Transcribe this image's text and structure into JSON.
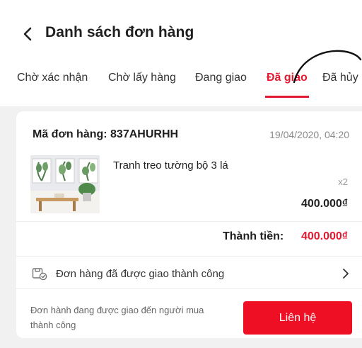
{
  "header": {
    "title": "Danh sách đơn hàng",
    "back_icon": "chevron-left-icon"
  },
  "tabs": [
    {
      "label": "Chờ xác nhận",
      "active": false
    },
    {
      "label": "Chờ lấy hàng",
      "active": false
    },
    {
      "label": "Đang giao",
      "active": false
    },
    {
      "label": "Đã giao",
      "active": true
    },
    {
      "label": "Đã hủy",
      "active": false
    }
  ],
  "colors": {
    "accent": "#e3192f",
    "button": "#ef0f24",
    "background": "#f1f1f1"
  },
  "order": {
    "id_text": "Mã đơn hàng: 837AHURHH",
    "date": "19/04/2020, 04:20",
    "product": {
      "name": "Tranh treo tường bộ 3 lá",
      "quantity": "x2",
      "price": "400.000₫"
    },
    "total_label": "Thành tiền:",
    "total_value": "400.000₫",
    "status_icon": "delivery-box-icon",
    "status_text": "Đơn hàng đã được giao thành công",
    "note": "Đơn hành đang được giao đến người mua thành công",
    "contact_label": "Liên hệ"
  }
}
